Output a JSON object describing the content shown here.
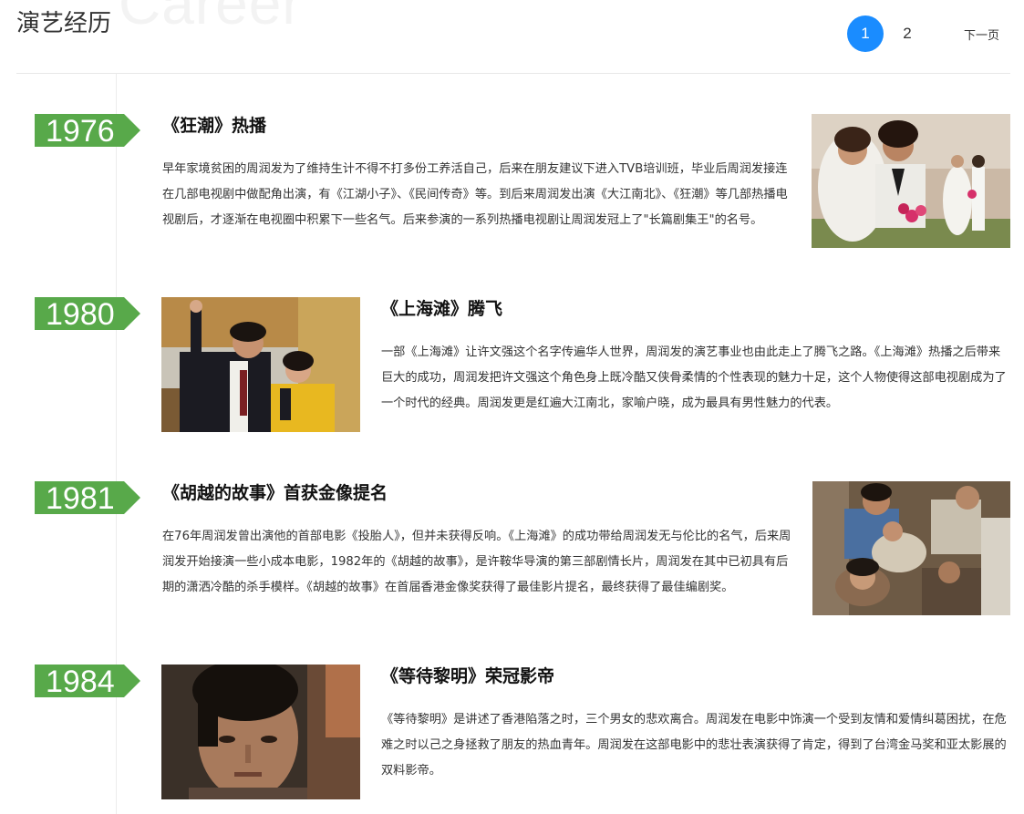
{
  "header": {
    "title": "演艺经历",
    "background_word": "Career"
  },
  "pagination": {
    "pages": [
      "1",
      "2"
    ],
    "active": "1",
    "next_label": "下一页",
    "accent": "#1a8cff"
  },
  "timeline": {
    "flag_color": "#58a94a",
    "entries": [
      {
        "year": "1976",
        "title": "《狂潮》热播",
        "description": "早年家境贫困的周润发为了维持生计不得不打多份工养活自己，后来在朋友建议下进入TVB培训班，毕业后周润发接连在几部电视剧中做配角出演，有《江湖小子》、《民间传奇》等。到后来周润发出演《大江南北》、《狂潮》等几部热播电视剧后，才逐渐在电视圈中积累下一些名气。后来参演的一系列热播电视剧让周润发冠上了\"长篇剧集王\"的名号。",
        "photo": "wedding-photo"
      },
      {
        "year": "1980",
        "title": "《上海滩》腾飞",
        "description": "一部《上海滩》让许文强这个名字传遍华人世界，周润发的演艺事业也由此走上了腾飞之路。《上海滩》热播之后带来巨大的成功，周润发把许文强这个角色身上既冷酷又侠骨柔情的个性表现的魅力十足，这个人物使得这部电视剧成为了一个时代的经典。周润发更是红遍大江南北，家喻户晓，成为最具有男性魅力的代表。",
        "photo": "shanghai-beach-photo"
      },
      {
        "year": "1981",
        "title": "《胡越的故事》首获金像提名",
        "description": "在76年周润发曾出演他的首部电影《投胎人》，但并未获得反响。《上海滩》的成功带给周润发无与伦比的名气，后来周润发开始接演一些小成本电影，1982年的《胡越的故事》，是许鞍华导演的第三部剧情长片，周润发在其中已初具有后期的潇洒冷酷的杀手模样。《胡越的故事》在首届香港金像奖获得了最佳影片提名，最终获得了最佳编剧奖。",
        "photo": "boat-people-photo"
      },
      {
        "year": "1984",
        "title": "《等待黎明》荣冠影帝",
        "description": "《等待黎明》是讲述了香港陷落之时，三个男女的悲欢离合。周润发在电影中饰演一个受到友情和爱情纠葛困扰，在危难之时以己之身拯救了朋友的热血青年。周润发在这部电影中的悲壮表演获得了肯定，得到了台湾金马奖和亚太影展的双料影帝。",
        "photo": "portrait-photo"
      }
    ]
  }
}
